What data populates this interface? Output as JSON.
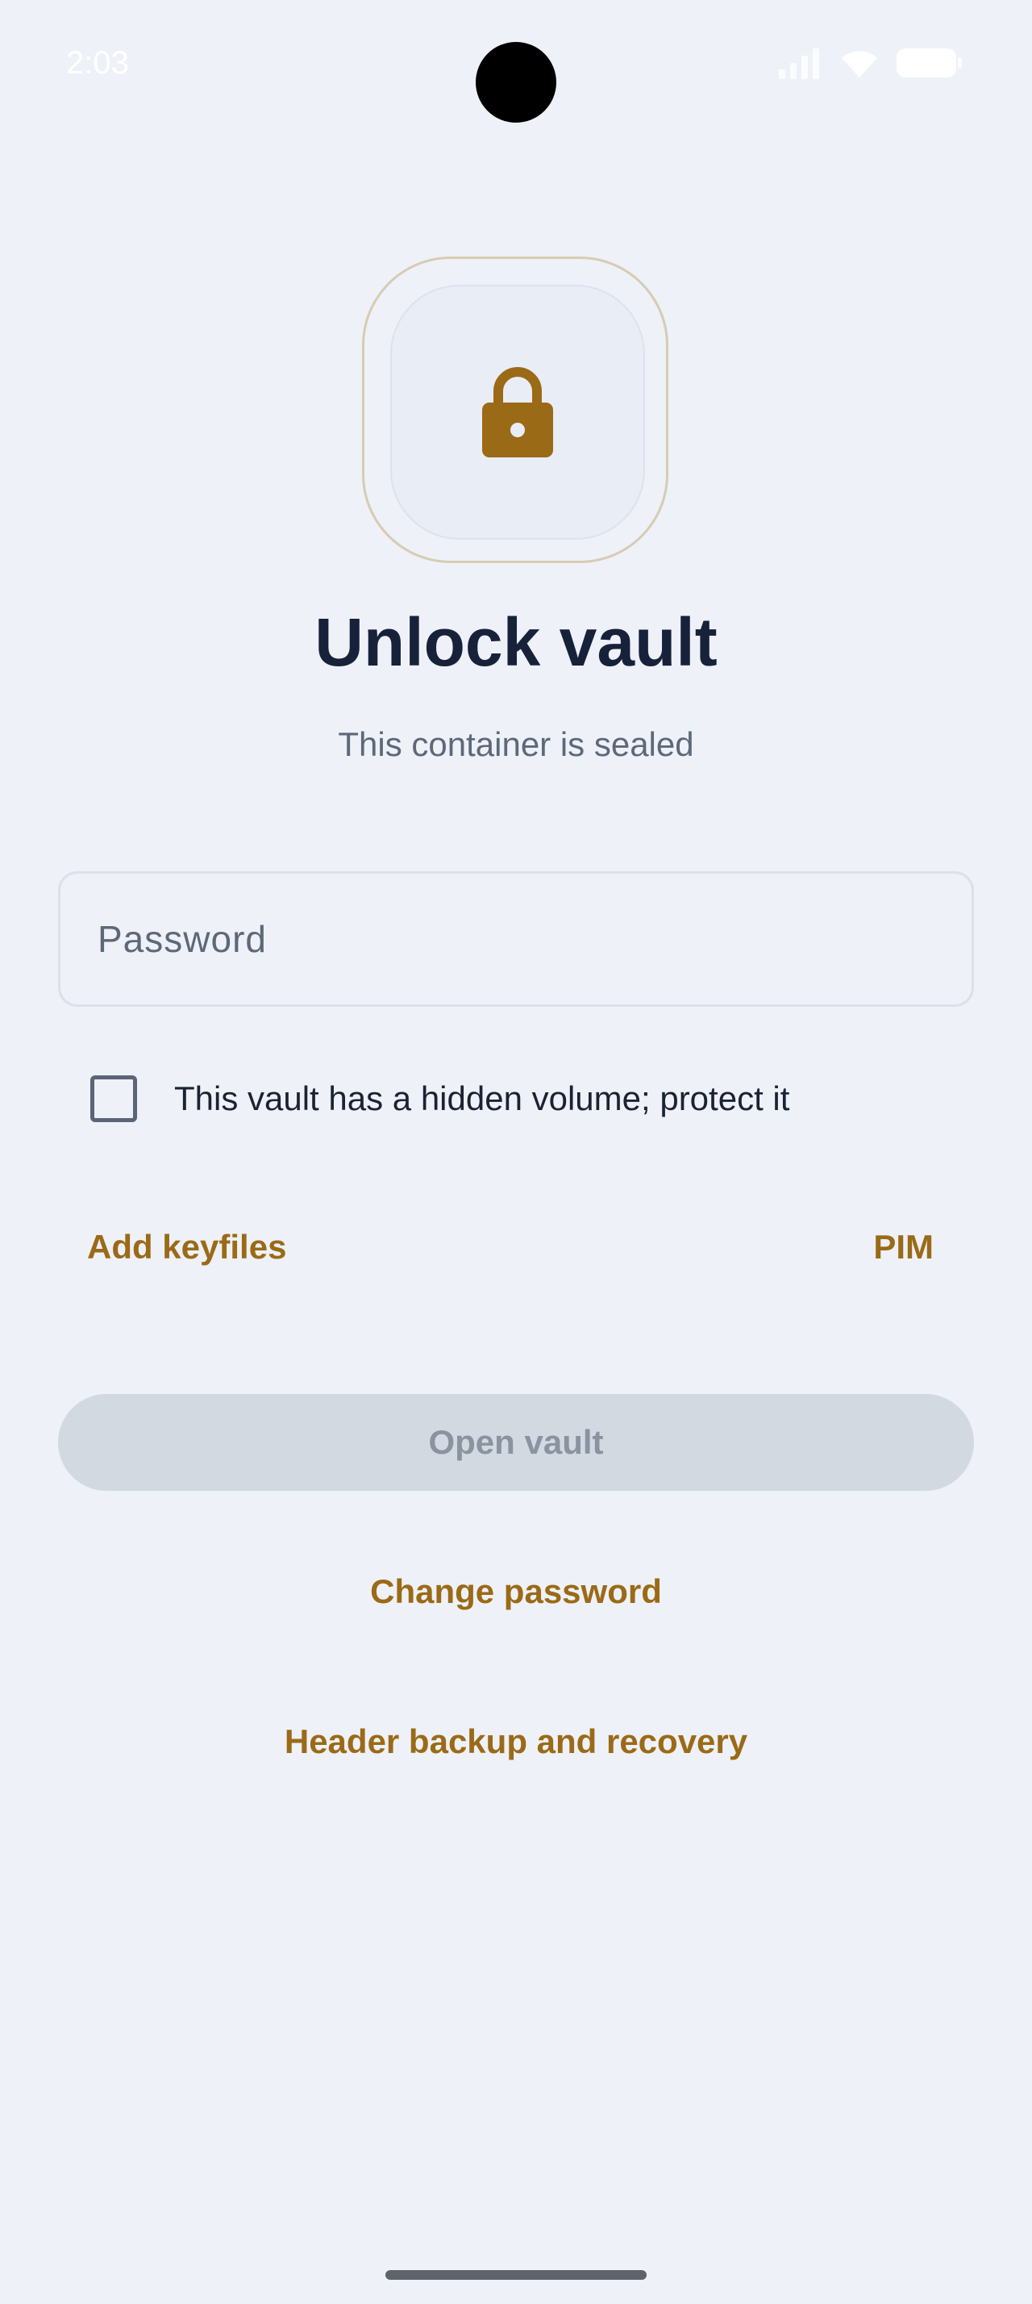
{
  "status_bar": {
    "time": "2:03",
    "icons": [
      "signal-icon",
      "wifi-icon",
      "battery-icon"
    ]
  },
  "header": {
    "icon": "lock-icon",
    "title": "Unlock vault",
    "subtitle": "This container is sealed"
  },
  "form": {
    "password_placeholder": "Password",
    "password_value": "",
    "hidden_volume_label": "This vault has a hidden volume; protect it",
    "hidden_volume_checked": false,
    "add_keyfiles_label": "Add keyfiles",
    "pim_label": "PIM",
    "open_button_label": "Open vault",
    "open_button_enabled": false
  },
  "links": {
    "change_password": "Change password",
    "header_backup": "Header backup and recovery"
  },
  "colors": {
    "background": "#eef1f8",
    "accent": "#9b6a17",
    "title": "#17213a",
    "muted_text": "#5d6879",
    "disabled_button": "#d3d9e1",
    "disabled_button_text": "#8b93a0"
  }
}
